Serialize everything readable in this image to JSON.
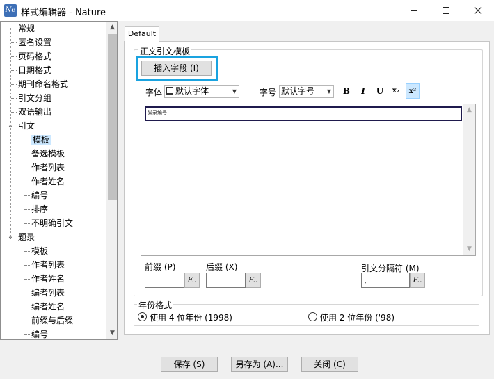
{
  "window": {
    "title": "样式编辑器 - Nature",
    "icon_text": "Ne"
  },
  "tree": {
    "items": [
      {
        "label": "常规",
        "level": 0
      },
      {
        "label": "匿名设置",
        "level": 0
      },
      {
        "label": "页码格式",
        "level": 0
      },
      {
        "label": "日期格式",
        "level": 0
      },
      {
        "label": "期刊命名格式",
        "level": 0
      },
      {
        "label": "引文分组",
        "level": 0
      },
      {
        "label": "双语输出",
        "level": 0
      },
      {
        "label": "引文",
        "level": 0,
        "expanded": true
      },
      {
        "label": "模板",
        "level": 1,
        "selected": true
      },
      {
        "label": "备选模板",
        "level": 1
      },
      {
        "label": "作者列表",
        "level": 1
      },
      {
        "label": "作者姓名",
        "level": 1
      },
      {
        "label": "编号",
        "level": 1
      },
      {
        "label": "排序",
        "level": 1
      },
      {
        "label": "不明确引文",
        "level": 1
      },
      {
        "label": "题录",
        "level": 0,
        "expanded": true
      },
      {
        "label": "模板",
        "level": 1
      },
      {
        "label": "作者列表",
        "level": 1
      },
      {
        "label": "作者姓名",
        "level": 1
      },
      {
        "label": "编者列表",
        "level": 1
      },
      {
        "label": "编者姓名",
        "level": 1
      },
      {
        "label": "前缀与后缀",
        "level": 1
      },
      {
        "label": "编号",
        "level": 1
      }
    ]
  },
  "tab": {
    "label": "Default"
  },
  "template_group": {
    "title": "正文引文模板",
    "insert_field_button": "插入字段 (I)",
    "font_label": "字体",
    "font_value": "默认字体",
    "size_label": "字号",
    "size_value": "默认字号",
    "format": {
      "bold": "B",
      "italic": "I",
      "underline": "U",
      "subscript": "x₂",
      "superscript": "x²"
    },
    "editor_content": "脚录编号"
  },
  "affixes": {
    "prefix_label": "前缀 (P)",
    "prefix_value": "",
    "suffix_label": "后缀 (X)",
    "suffix_value": "",
    "separator_label": "引文分隔符 (M)",
    "separator_value": ",",
    "font_button": "F.."
  },
  "year_group": {
    "title": "年份格式",
    "option_4digit": "使用 4 位年份 (1998)",
    "option_2digit": "使用 2 位年份 ('98)",
    "selected": "4digit"
  },
  "buttons": {
    "save": "保存 (S)",
    "save_as": "另存为 (A)...",
    "close": "关闭 (C)"
  },
  "colors": {
    "highlight": "#1aa3e0",
    "selection": "#cce8ff"
  }
}
